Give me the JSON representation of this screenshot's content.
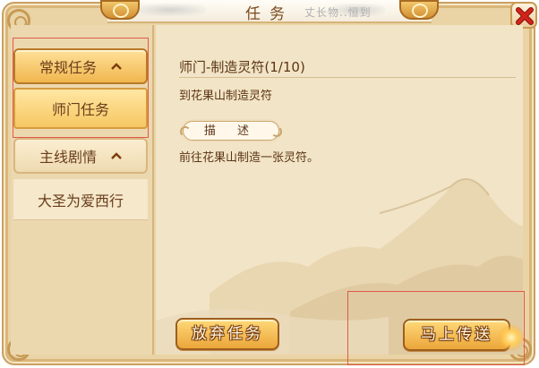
{
  "window": {
    "title": "任务",
    "title_watermark": "丈长物..恒到"
  },
  "sidebar": {
    "categories": [
      {
        "label": "常规任务",
        "expanded": true,
        "items": [
          {
            "label": "师门任务",
            "selected": true
          }
        ]
      },
      {
        "label": "主线剧情",
        "expanded": true,
        "items": [
          {
            "label": "大圣为爱西行",
            "selected": false
          }
        ]
      }
    ]
  },
  "quest": {
    "title": "师门-制造灵符(1/10)",
    "target": "到花果山制造灵符",
    "desc_label": "描 述",
    "description": "前往花果山制造一张灵符。"
  },
  "actions": {
    "abandon_label": "放弃任务",
    "teleport_label": "马上传送"
  },
  "colors": {
    "panel_bg": "#f2e4c6",
    "button_gold": "#f1b64f",
    "close_red": "#d2231b",
    "text_brown": "#5c3517"
  }
}
